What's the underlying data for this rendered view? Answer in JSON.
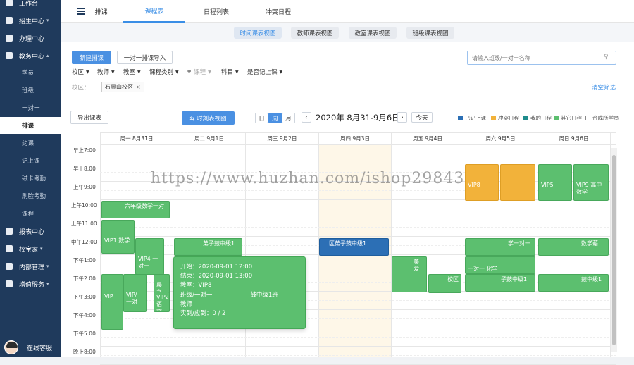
{
  "sidebar": {
    "items": [
      {
        "label": "工作台",
        "icon": "home-icon"
      },
      {
        "label": "招生中心",
        "icon": "user-icon",
        "arrow": "▾"
      },
      {
        "label": "办理中心",
        "icon": "document-icon"
      },
      {
        "label": "教务中心",
        "icon": "book-icon",
        "arrow": "▴"
      }
    ],
    "subitems": [
      "学员",
      "班级",
      "一对一",
      "排课",
      "约课",
      "记上课",
      "磁卡考勤",
      "刷脸考勤",
      "课程"
    ],
    "bottom_items": [
      {
        "label": "报表中心",
        "icon": "chart-icon"
      },
      {
        "label": "校宝家",
        "icon": "house-icon",
        "arrow": "▾"
      },
      {
        "label": "内部管理",
        "icon": "people-icon",
        "arrow": "▾"
      },
      {
        "label": "增值服务",
        "icon": "grid-icon",
        "arrow": "▾"
      }
    ],
    "user_name": "在线客服"
  },
  "top_tabs": [
    "排课",
    "课程表",
    "日程列表",
    "冲突日程"
  ],
  "sub_tabs": [
    "时间课表视图",
    "教师课表视图",
    "教室课表视图",
    "班级课表视图"
  ],
  "toolbar": {
    "new_button": "新建排课",
    "import_button": "一对一排课导入",
    "search_placeholder": "请输入班级/一对一名称"
  },
  "filters": [
    "校区",
    "教师",
    "教室",
    "课程类别",
    "课程",
    "科目",
    "是否记上课"
  ],
  "campus": {
    "label": "校区：",
    "tag": "石景山校区",
    "clear": "清空筛选"
  },
  "calendar": {
    "export": "导出课表",
    "view_switch": "⇆ 时刻表视图",
    "modes": [
      "日",
      "周",
      "月"
    ],
    "range": "2020年 8月31-9月6日",
    "today": "今天",
    "legend": [
      {
        "label": "已记上课",
        "color": "#2c6fb5"
      },
      {
        "label": "冲突日程",
        "color": "#f2b23a"
      },
      {
        "label": "我的日程",
        "color": "#1f8c8c"
      },
      {
        "label": "其它日程",
        "color": "#5cbf6f"
      },
      {
        "label": "合成所学员",
        "color": "#ffffff"
      }
    ],
    "days": [
      "周一 8月31日",
      "周二 9月1日",
      "周三 9月2日",
      "周四 9月3日",
      "周五 9月4日",
      "周六 9月5日",
      "周日 9月6日"
    ],
    "times": [
      "早上7:00",
      "早上8:00",
      "上午9:00",
      "上午10:00",
      "上午11:00",
      "中午12:00",
      "下午1:00",
      "下午2:00",
      "下午3:00",
      "下午4:00",
      "下午5:00",
      "晚上8:00"
    ],
    "events": [
      {
        "text": "六年级数学一对",
        "color": "g"
      },
      {
        "text": "VIP1 数学",
        "color": "g"
      },
      {
        "text": "VIP4 一对一",
        "color": "g"
      },
      {
        "text": "晨之 工作",
        "color": "g"
      },
      {
        "text": "VIP2 语文",
        "color": "g"
      },
      {
        "text": "VIP/ 一对",
        "color": "g"
      },
      {
        "text": "VIP",
        "color": "g"
      },
      {
        "text": "弟子鼓中级1",
        "color": "g"
      },
      {
        "text": "区弟子鼓中级1",
        "color": "b"
      },
      {
        "text": "美爱",
        "color": "g"
      },
      {
        "text": "校区",
        "color": "g"
      },
      {
        "text": "VIP8",
        "color": "o"
      },
      {
        "text": "",
        "color": "o"
      },
      {
        "text": "VIP9 高中数学",
        "color": "g"
      },
      {
        "text": "VIP5",
        "color": "g"
      },
      {
        "text": "学一对一",
        "color": "g"
      },
      {
        "text": "一对一 化学",
        "color": "g"
      },
      {
        "text": "子鼓中级1",
        "color": "g"
      },
      {
        "text": "数学藉",
        "color": "g"
      },
      {
        "text": "鼓中级1",
        "color": "g"
      }
    ]
  },
  "tooltip": {
    "start": "开始：2020-09-01 12:00",
    "end": "结束：2020-09-01 13:00",
    "room": "教室：VIP8",
    "class": "班级/一对一                    鼓中级1班",
    "teacher": "教师",
    "count": "实到/应到：0 / 2"
  },
  "watermark": "https://www.huzhan.com/ishop29843"
}
